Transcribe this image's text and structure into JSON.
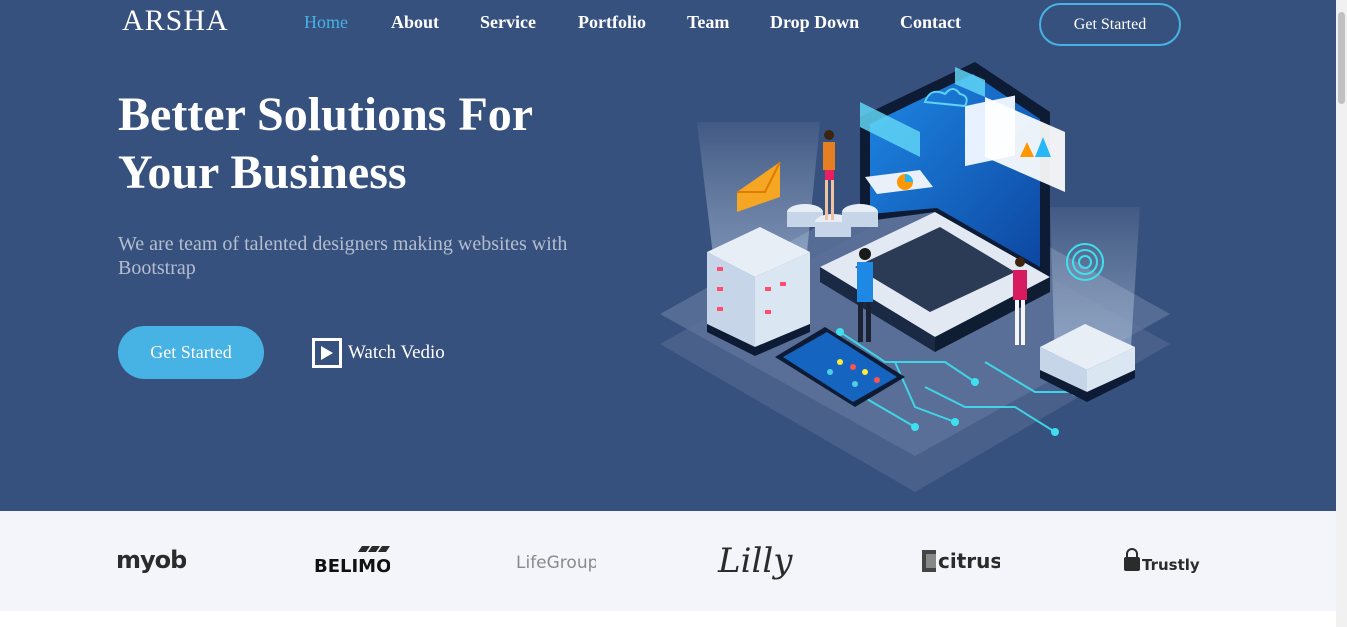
{
  "brand": {
    "name": "ARSHA"
  },
  "nav": {
    "items": [
      {
        "label": "Home",
        "active": true
      },
      {
        "label": "About"
      },
      {
        "label": "Service"
      },
      {
        "label": "Portfolio"
      },
      {
        "label": "Team"
      },
      {
        "label": "Drop Down"
      },
      {
        "label": "Contact"
      }
    ],
    "cta_label": "Get Started"
  },
  "hero": {
    "title_line1": "Better Solutions For",
    "title_line2": "Your Business",
    "subtitle": "We are team of talented designers making websites with Bootstrap",
    "primary_button": "Get Started",
    "video_button": "Watch Vedio",
    "play_icon": "play-icon",
    "illustration": "isometric-laptop-illustration"
  },
  "clients": {
    "logos": [
      "myob",
      "BELIMO",
      "LifeGroups",
      "Lilly",
      "citrus",
      "Trustly"
    ]
  },
  "colors": {
    "hero_bg": "#37517e",
    "accent": "#47b2e4",
    "clients_bg": "#f3f5fa"
  }
}
